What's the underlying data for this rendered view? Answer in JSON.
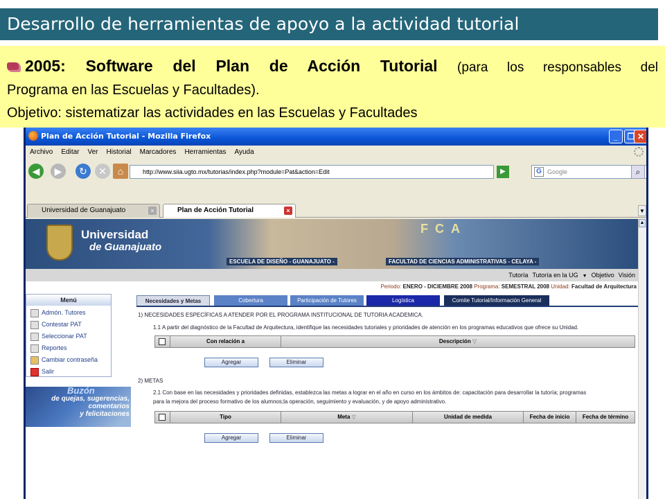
{
  "slide": {
    "title": "Desarrollo de herramientas de apoyo a la actividad tutorial",
    "bold_text": "2005: Software del Plan de Acción Tutorial",
    "paren_text": "(para los responsables del",
    "line2": "Programa en las Escuelas y Facultades).",
    "line3": "Objetivo: sistematizar las actividades en las Escuelas y Facultades"
  },
  "browser": {
    "window_title": "Plan de Acción Tutorial - Mozilla Firefox",
    "menu": [
      "Archivo",
      "Editar",
      "Ver",
      "Historial",
      "Marcadores",
      "Herramientas",
      "Ayuda"
    ],
    "url": "http://www.siia.ugto.mx/tutorias/index.php?module=Pat&action=Edit",
    "search_placeholder": "Google",
    "tabs": [
      "Universidad de Guanajuato",
      "Plan de Acción Tutorial"
    ]
  },
  "page": {
    "university_name": "Universidad",
    "university_sub": "de Guanajuato",
    "banner_fca": "FCA",
    "banner_caption_left": "ESCUELA DE DISEÑO - GUANAJUATO -",
    "banner_caption_right": "FACULTAD DE CIENCIAS ADMINISTRATIVAS - CELAYA -",
    "top_nav": [
      "Tutoría",
      "Tutoría en la UG",
      "Objetivo",
      "Visión"
    ],
    "period_label": "Periodo:",
    "period_value": "ENERO - DICIEMBRE 2008",
    "program_label": "Programa:",
    "program_value": "SEMESTRAL 2008",
    "unit_label": "Unidad:",
    "unit_value": "Facultad de Arquitectura",
    "menu_title": "Menú",
    "menu_items": [
      "Admón. Tutores",
      "Contestar PAT",
      "Seleccionar PAT",
      "Reportes",
      "Cambiar contraseña",
      "Salir"
    ],
    "buzon_title": "Buzón",
    "buzon_line1": "de quejas, sugerencias,",
    "buzon_line2": "comentarios",
    "buzon_line3": "y felicitaciones",
    "content_tabs": [
      "Necesidades y Metas",
      "Cobertura",
      "Participación de Tutores",
      "Logística",
      "Comite Tutorial/Información General"
    ],
    "section1_title": "1) NECESIDADES ESPECÍFICAS A ATENDER POR EL PROGRAMA INSTITUCIONAL DE TUTORIA ACADEMICA.",
    "section1_text": "1.1 A partir del diagnóstico de la Facultad de Arquitectura, identifique las necesidades tutoriales y prioridades de atención en los programas educativos que ofrece su Unidad.",
    "table1_headers": [
      "Con relación a",
      "Descripción"
    ],
    "section2_title": "2) METAS",
    "section2_text1": "2.1 Con base en las necesidades y prioridades definidas, establezca las metas a lograr en el año en curso en los ámbitos de: capacitación para desarrollar la tutoría; programas",
    "section2_text2": "para la mejora del proceso formativo de los alumnos;la operación, seguimiento y evaluación, y de apoyo administrativo.",
    "table2_headers": [
      "Tipo",
      "Meta",
      "Unidad de medida",
      "Fecha de inicio",
      "Fecha de término"
    ],
    "add_button": "Agregar",
    "delete_button": "Eliminar"
  }
}
